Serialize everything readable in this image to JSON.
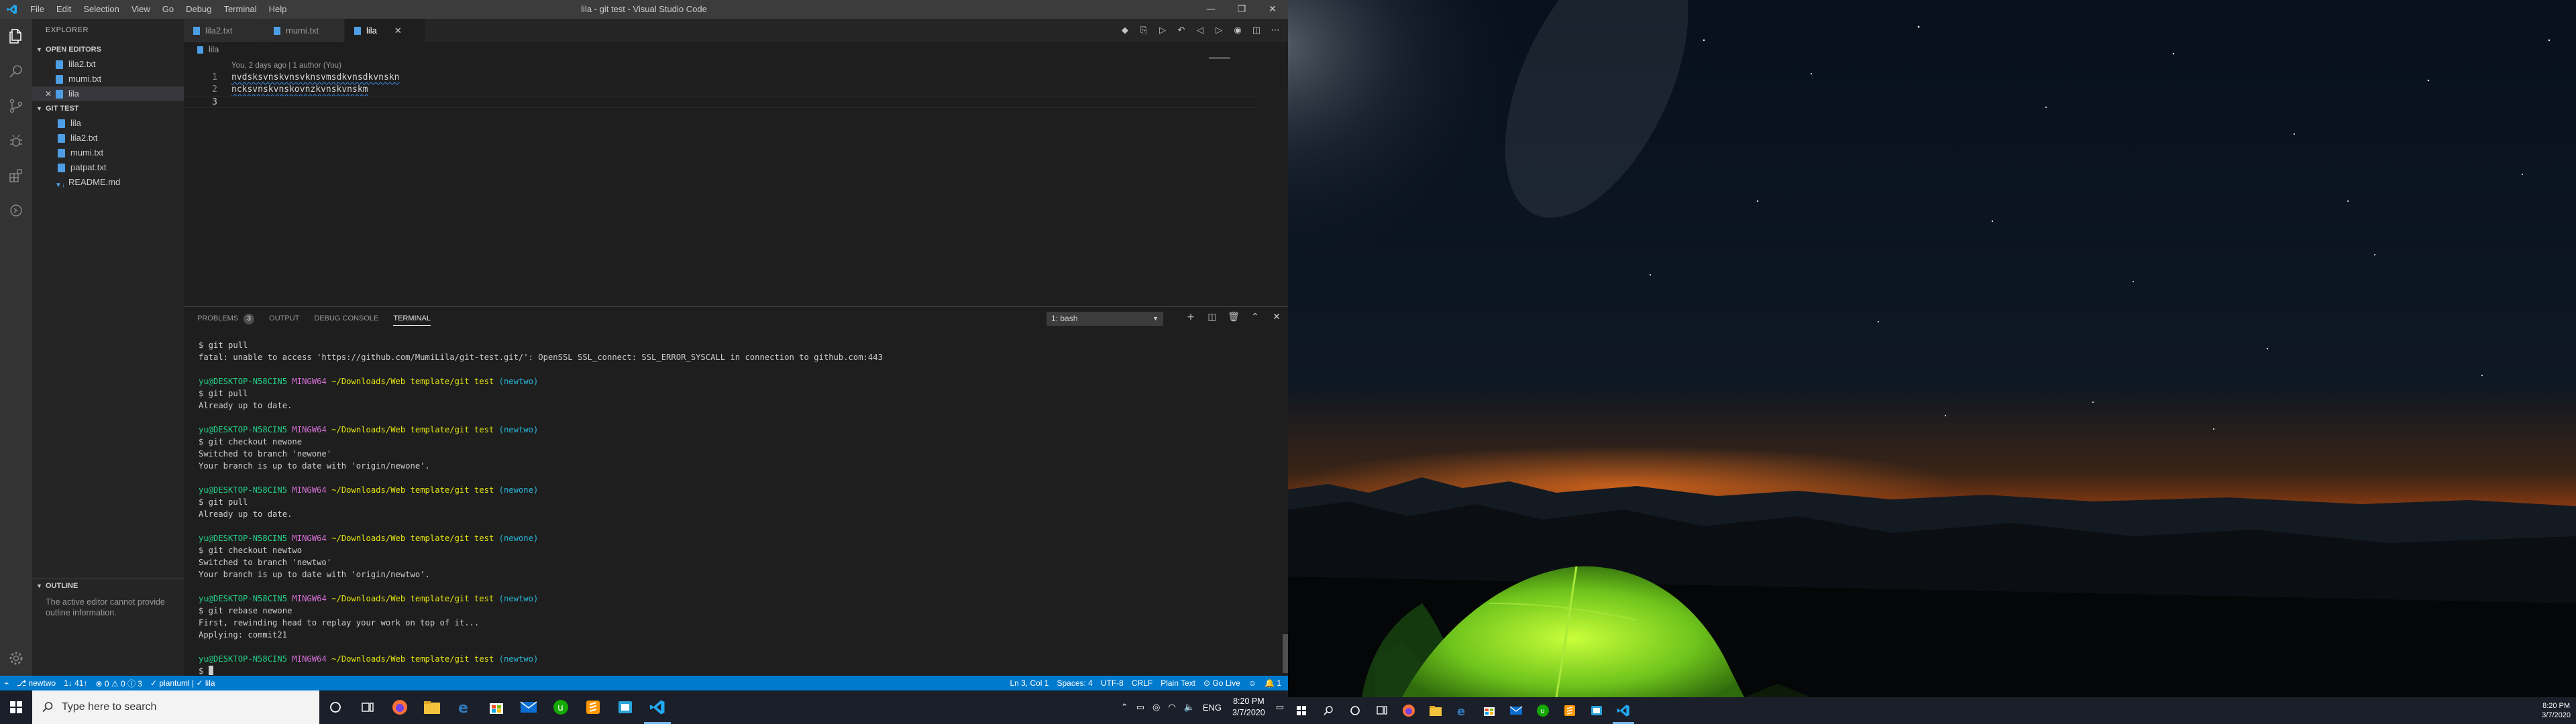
{
  "window": {
    "title": "lila - git test - Visual Studio Code",
    "menu": [
      "File",
      "Edit",
      "Selection",
      "View",
      "Go",
      "Debug",
      "Terminal",
      "Help"
    ]
  },
  "sidebar": {
    "title": "EXPLORER",
    "open_editors_label": "OPEN EDITORS",
    "open_editors": [
      "lila2.txt",
      "mumi.txt",
      "lila"
    ],
    "folder_label": "GIT TEST",
    "files": [
      "lila",
      "lila2.txt",
      "mumi.txt",
      "patpat.txt",
      "README.md"
    ],
    "outline_label": "OUTLINE",
    "outline_message": "The active editor cannot provide outline information."
  },
  "tabs": [
    "lila2.txt",
    "mumi.txt",
    "lila"
  ],
  "breadcrumb": "lila",
  "editor": {
    "codelens": "You, 2 days ago | 1 author (You)",
    "lines": [
      {
        "num": "1",
        "text": "nvdsksvnskvnsvknsvmsdkvnsdkvnskn"
      },
      {
        "num": "2",
        "text": "ncksvnskvnskovnzkvnskvnskm"
      },
      {
        "num": "3",
        "text": ""
      }
    ]
  },
  "panel": {
    "tabs": [
      "PROBLEMS",
      "OUTPUT",
      "DEBUG CONSOLE",
      "TERMINAL"
    ],
    "problems_count": "3",
    "terminal_select": "1: bash",
    "prompt": {
      "user": "yu@DESKTOP-N58CIN5",
      "env": "MINGW64",
      "path": "~/Downloads/Web template/git test"
    },
    "blocks": [
      {
        "branch": null,
        "cmd": "$ git pull",
        "out": [
          "fatal: unable to access 'https://github.com/MumiLila/git-test.git/': OpenSSL SSL_connect: SSL_ERROR_SYSCALL in connection to github.com:443"
        ]
      },
      {
        "branch": "(newtwo)",
        "cmd": "$ git pull",
        "out": [
          "Already up to date."
        ]
      },
      {
        "branch": "(newtwo)",
        "cmd": "$ git checkout newone",
        "out": [
          "Switched to branch 'newone'",
          "Your branch is up to date with 'origin/newone'."
        ]
      },
      {
        "branch": "(newone)",
        "cmd": "$ git pull",
        "out": [
          "Already up to date."
        ]
      },
      {
        "branch": "(newone)",
        "cmd": "$ git checkout newtwo",
        "out": [
          "Switched to branch 'newtwo'",
          "Your branch is up to date with 'origin/newtwo'."
        ]
      },
      {
        "branch": "(newtwo)",
        "cmd": "$ git rebase newone",
        "out": [
          "First, rewinding head to replay your work on top of it...",
          "Applying: commit21"
        ]
      },
      {
        "branch": "(newtwo)",
        "cmd": "$ ",
        "out": []
      }
    ]
  },
  "statusbar": {
    "branch": "newtwo",
    "sync": "1↓ 41↑",
    "problems": "⊗ 0 ⚠ 0 ⓘ 3",
    "plantuml": "✓ plantuml | ✓ lila",
    "position": "Ln 3, Col 1",
    "spaces": "Spaces: 4",
    "encoding": "UTF-8",
    "eol": "CRLF",
    "language": "Plain Text",
    "golive": "Go Live",
    "notifications": "1"
  },
  "taskbar": {
    "search_placeholder": "Type here to search",
    "language": "ENG",
    "time": "8:20 PM",
    "date": "3/7/2020"
  },
  "colors": {
    "accent": "#007acc",
    "prompt_user": "#23d18b",
    "prompt_env": "#d670d6",
    "prompt_path": "#e5e510",
    "prompt_branch": "#29b8db"
  }
}
